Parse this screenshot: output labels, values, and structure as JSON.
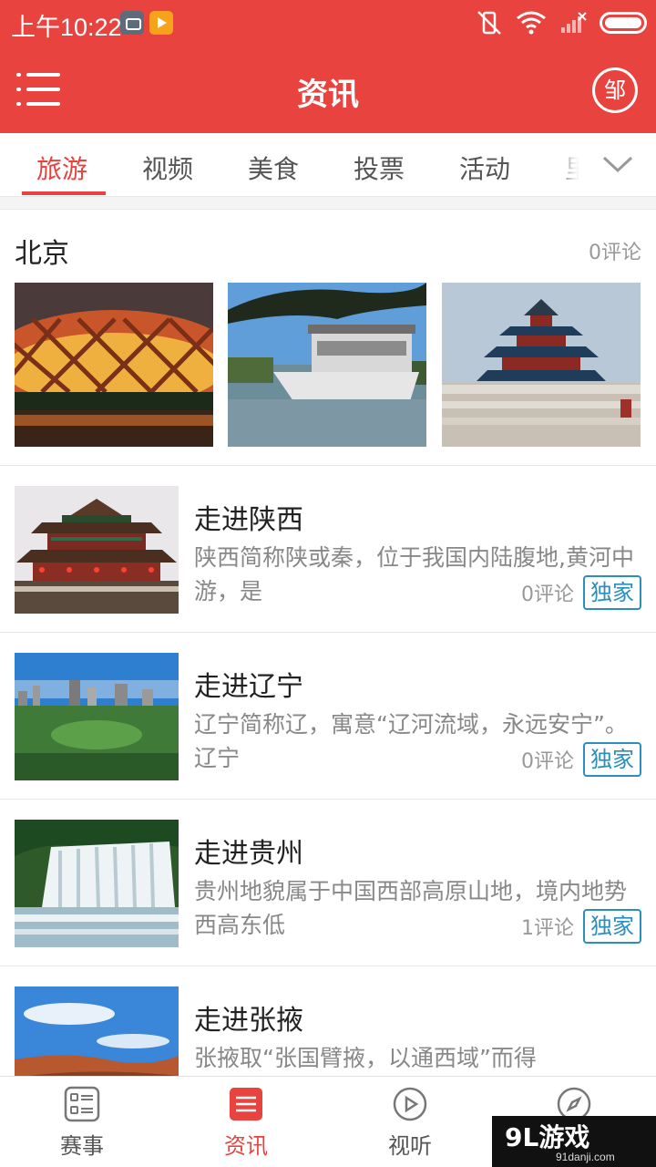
{
  "status_bar": {
    "time": "上午10:22"
  },
  "header": {
    "title": "资讯",
    "city_label": "邹"
  },
  "tabs": [
    {
      "label": "旅游",
      "active": true
    },
    {
      "label": "视频",
      "active": false
    },
    {
      "label": "美食",
      "active": false
    },
    {
      "label": "投票",
      "active": false
    },
    {
      "label": "活动",
      "active": false
    },
    {
      "label": "里",
      "active": false
    }
  ],
  "gallery": {
    "title": "北京",
    "comments": "0评论"
  },
  "items": [
    {
      "title": "走进陕西",
      "desc": "陕西简称陕或秦，位于我国内陆腹地,黄河中游，是",
      "comments": "0评论",
      "badge": "独家"
    },
    {
      "title": "走进辽宁",
      "desc": "辽宁简称辽，寓意“辽河流域，永远安宁”。 辽宁",
      "comments": "0评论",
      "badge": "独家"
    },
    {
      "title": "走进贵州",
      "desc": "贵州地貌属于中国西部高原山地，境内地势西高东低",
      "comments": "1评论",
      "badge": "独家"
    },
    {
      "title": "走进张掖",
      "desc": "张掖取“张国臂掖，以通西域”而得"
    }
  ],
  "bottom_nav": [
    {
      "label": "赛事",
      "icon": "grid-list-icon",
      "active": false
    },
    {
      "label": "资讯",
      "icon": "news-list-icon",
      "active": true
    },
    {
      "label": "视听",
      "icon": "play-circle-icon",
      "active": false
    },
    {
      "label": "",
      "icon": "compass-icon",
      "active": false
    }
  ],
  "watermark": {
    "main": "9L游戏",
    "sub": "91danji.com"
  },
  "colors": {
    "accent": "#e8433f",
    "badge": "#2a8fbd"
  }
}
